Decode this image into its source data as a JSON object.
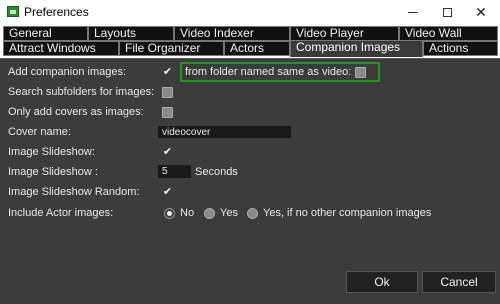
{
  "window": {
    "title": "Preferences"
  },
  "tabs": {
    "row1": [
      "General",
      "Layouts",
      "Video Indexer",
      "Video Player",
      "Video Wall"
    ],
    "row2": [
      "Attract Windows",
      "File Organizer",
      "Actors",
      "Companion Images",
      "Actions"
    ],
    "active": "Companion Images"
  },
  "settings": {
    "add_companion": {
      "label": "Add companion images:",
      "checked": true
    },
    "same_name_folder": {
      "label": "from folder named same as video:",
      "checked": false
    },
    "search_subfolders": {
      "label": "Search subfolders for images:",
      "checked": false
    },
    "only_covers": {
      "label": "Only add covers as images:",
      "checked": false
    },
    "cover_name": {
      "label": "Cover name:",
      "value": "videocover"
    },
    "slideshow": {
      "label": "Image Slideshow:",
      "checked": true
    },
    "slideshow_seconds": {
      "label": "Image Slideshow :",
      "value": "5",
      "unit": "Seconds"
    },
    "slideshow_random": {
      "label": "Image Slideshow Random:",
      "checked": true
    },
    "include_actor": {
      "label": "Include Actor images:",
      "options": [
        "No",
        "Yes",
        "Yes, if no other companion images"
      ],
      "selected": "No"
    }
  },
  "buttons": {
    "ok": "Ok",
    "cancel": "Cancel"
  },
  "colors": {
    "highlight_border": "#1d9a1d",
    "panel_bg": "#3c3c3c",
    "tab_bg": "#111111"
  }
}
